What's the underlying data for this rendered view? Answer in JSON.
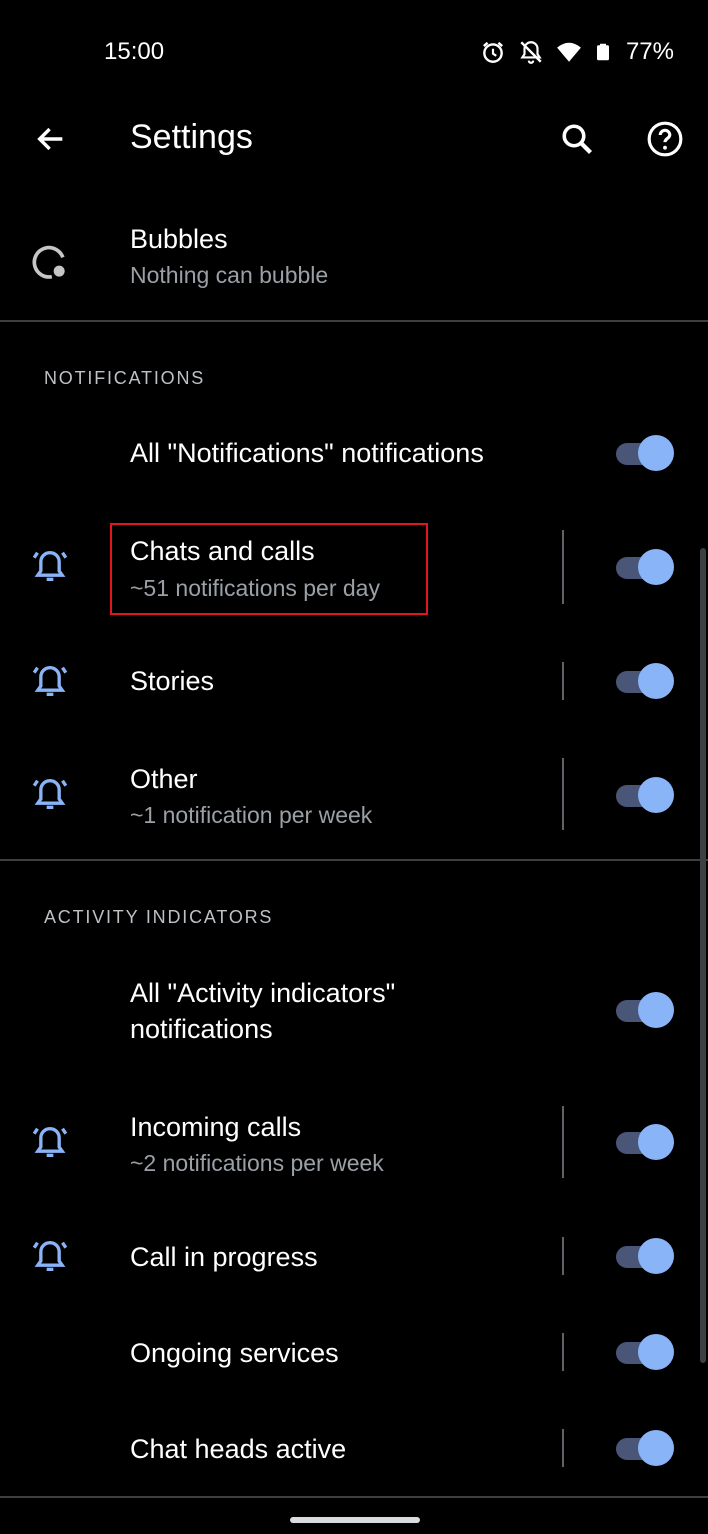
{
  "status_bar": {
    "time": "15:00",
    "battery_percent": "77%",
    "icons": [
      "alarm-icon",
      "notifications-off-icon",
      "wifi-icon",
      "battery-icon"
    ]
  },
  "app_bar": {
    "title": "Settings",
    "icons": [
      "back-arrow-icon",
      "search-icon",
      "help-icon"
    ]
  },
  "bubbles": {
    "title": "Bubbles",
    "subtitle": "Nothing can bubble",
    "icon": "bubble-icon"
  },
  "notifications_section": {
    "header": "NOTIFICATIONS",
    "items": [
      {
        "title": "All \"Notifications\" notifications",
        "subtitle": "",
        "enabled": true
      },
      {
        "title": "Chats and calls",
        "subtitle": "~51 notifications per day",
        "enabled": true,
        "icon": "alert-bell-icon"
      },
      {
        "title": "Stories",
        "subtitle": "",
        "enabled": true,
        "icon": "alert-bell-icon"
      },
      {
        "title": "Other",
        "subtitle": "~1 notification per week",
        "enabled": true,
        "icon": "alert-bell-icon"
      }
    ]
  },
  "activity_section": {
    "header": "ACTIVITY INDICATORS",
    "items": [
      {
        "title": "All \"Activity indicators\"",
        "title_line2": "notifications",
        "enabled": true
      },
      {
        "title": "Incoming calls",
        "subtitle": "~2 notifications per week",
        "enabled": true,
        "icon": "alert-bell-icon"
      },
      {
        "title": "Call in progress",
        "subtitle": "",
        "enabled": true,
        "icon": "alert-bell-icon"
      },
      {
        "title": "Ongoing services",
        "subtitle": "",
        "enabled": true
      },
      {
        "title": "Chat heads active",
        "subtitle": "",
        "enabled": true
      }
    ]
  },
  "colors": {
    "background": "#000000",
    "accent": "#8ab4f8",
    "toggle_track": "#4a5677",
    "highlight": "#e0181e",
    "divider": "#3c4043"
  }
}
